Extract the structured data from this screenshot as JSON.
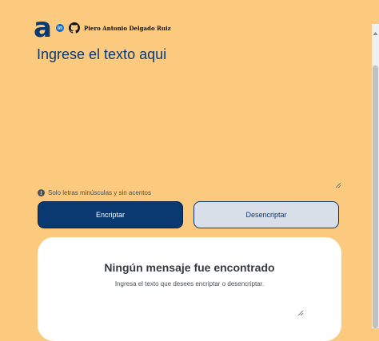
{
  "header": {
    "logo_letter": "a",
    "linkedin_label": "in",
    "author": "Piero Antonio Delgado Ruiz"
  },
  "input": {
    "placeholder": "Ingrese el texto aqui",
    "value": ""
  },
  "hint": {
    "icon_glyph": "!",
    "text": "Solo letras minúsculas y sin acentos"
  },
  "buttons": {
    "encrypt_label": "Encriptar",
    "decrypt_label": "Desencriptar"
  },
  "result": {
    "title": "Ningún mensaje fue encontrado",
    "subtitle": "Ingresa el texto que desees encriptar o desencriptar."
  },
  "colors": {
    "background": "#fcca7e",
    "primary": "#0a3871",
    "secondary_button": "#d8dfe8",
    "card": "#ffffff"
  }
}
